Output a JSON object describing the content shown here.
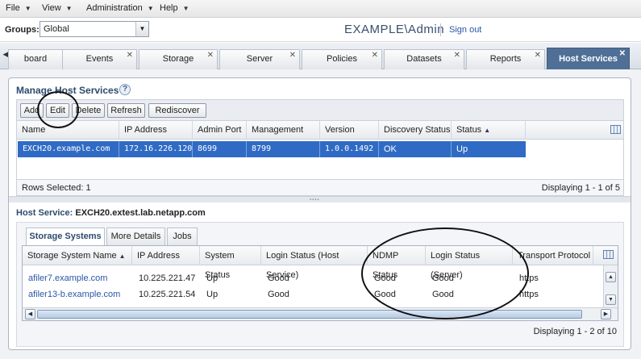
{
  "menubar": {
    "items": [
      {
        "label": "File"
      },
      {
        "label": "View"
      },
      {
        "label": "Administration"
      },
      {
        "label": "Help"
      }
    ]
  },
  "groups": {
    "label": "Groups:",
    "value": "Global"
  },
  "brand": "EXAMPLE\\Admin",
  "signout": "Sign out",
  "tabs": [
    {
      "label": "board"
    },
    {
      "label": "Events"
    },
    {
      "label": "Storage"
    },
    {
      "label": "Server"
    },
    {
      "label": "Policies"
    },
    {
      "label": "Datasets"
    },
    {
      "label": "Reports"
    },
    {
      "label": "Host Services",
      "active": true
    }
  ],
  "panel": {
    "title": "Manage Host Services",
    "help": "?"
  },
  "toolbar": {
    "add": "Add",
    "edit": "Edit",
    "delete": "Delete",
    "refresh": "Refresh",
    "rediscover": "Rediscover"
  },
  "host_table": {
    "columns": [
      "Name",
      "IP Address",
      "Admin Port",
      "Management Port",
      "Version",
      "Discovery Status",
      "Status"
    ],
    "sorted_column": "Status",
    "rows": [
      {
        "name": "EXCH20.example.com",
        "ip": "172.16.226.120",
        "admin_port": "8699",
        "management_port": "8799",
        "version": "1.0.0.1492",
        "discovery_status": "OK",
        "status": "Up",
        "selected": true
      }
    ]
  },
  "rows_selected": "Rows Selected: 1",
  "displaying_top": "Displaying 1 - 1 of 5",
  "detail": {
    "host_service_label": "Host Service:",
    "host_service_value": "EXCH20.extest.lab.netapp.com",
    "tabs": [
      {
        "label": "Storage Systems",
        "active": true
      },
      {
        "label": "More Details"
      },
      {
        "label": "Jobs"
      }
    ]
  },
  "storage_table": {
    "columns": [
      "Storage System Name",
      "IP Address",
      "System Status",
      "Login Status (Host Service)",
      "NDMP Status",
      "Login Status (Server)",
      "Transport Protocol"
    ],
    "sorted_column": "Storage System Name",
    "rows": [
      {
        "name": "afiler7.example.com",
        "ip": "10.225.221.47",
        "system_status": "Up",
        "login_host": "Good",
        "ndmp": "Good",
        "login_server": "Good",
        "transport": "https"
      },
      {
        "name": "afiler13-b.example.com",
        "ip": "10.225.221.54",
        "system_status": "Up",
        "login_host": "Good",
        "ndmp": "Good",
        "login_server": "Good",
        "transport": "https"
      }
    ]
  },
  "displaying_bottom": "Displaying 1 - 2 of 10",
  "colors": {
    "accent": "#4f6f96",
    "selection": "#2f6bc4",
    "link": "#2a56a8"
  }
}
